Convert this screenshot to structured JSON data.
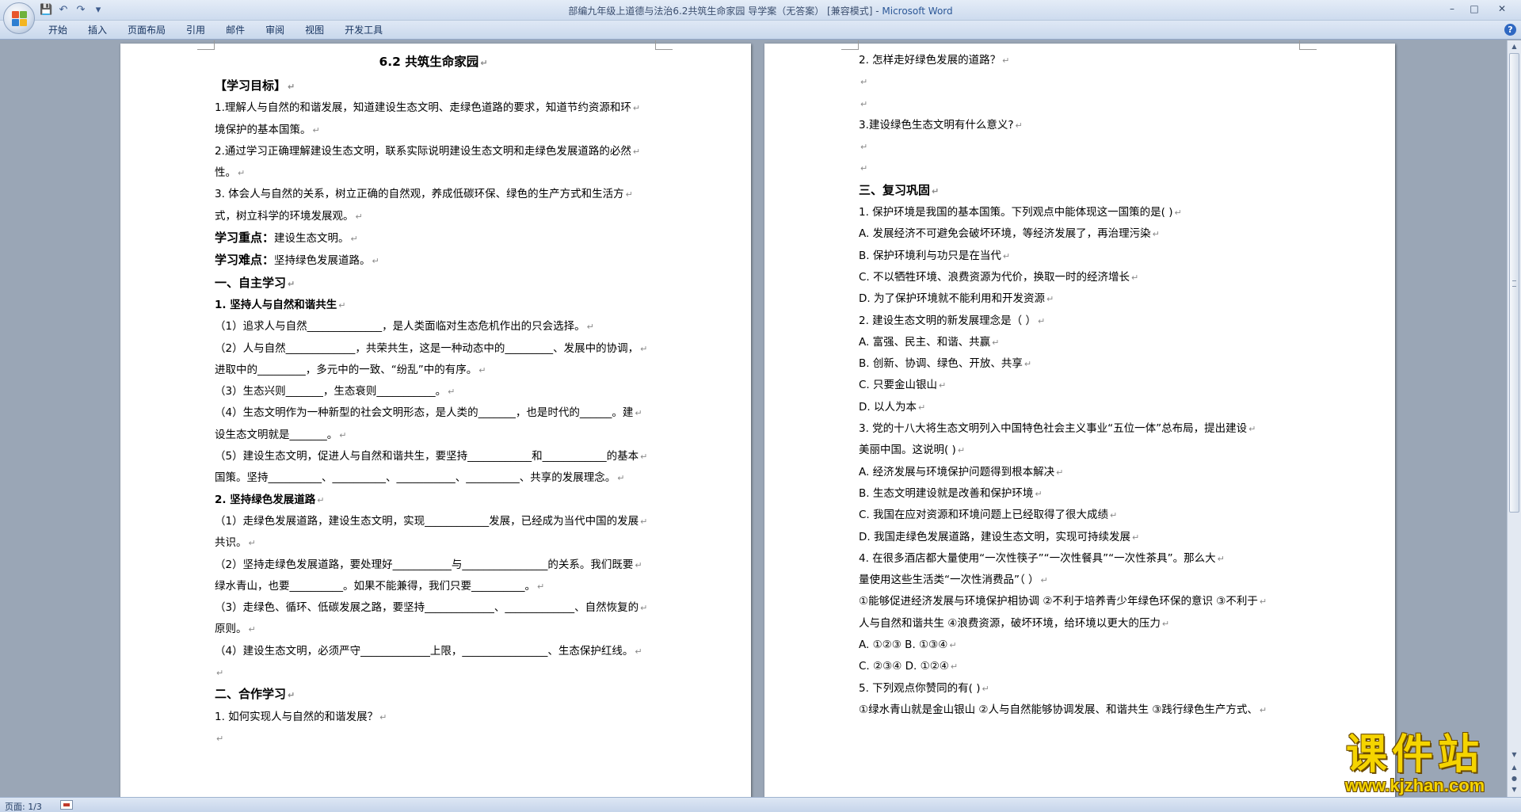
{
  "window": {
    "title": "部编九年级上道德与法治6.2共筑生命家园 导学案（无答案） [兼容模式] - ",
    "app_name": "Microsoft Word",
    "controls": [
      "–",
      "□",
      "✕"
    ]
  },
  "ribbon": {
    "tabs": [
      "开始",
      "插入",
      "页面布局",
      "引用",
      "邮件",
      "审阅",
      "视图",
      "开发工具"
    ]
  },
  "colors": {
    "office_logo": [
      "#e8572d",
      "#6fb23d",
      "#2f7fd1",
      "#f4b521"
    ]
  },
  "page1": {
    "lines": [
      {
        "t": "6.2  共筑生命家园",
        "s": "title"
      },
      {
        "t": "【学习目标】",
        "s": "h"
      },
      {
        "t": "1.理解人与自然的和谐发展，知道建设生态文明、走绿色道路的要求，知道节约资源和环"
      },
      {
        "t": "境保护的基本国策。"
      },
      {
        "t": "2.通过学习正确理解建设生态文明，联系实际说明建设生态文明和走绿色发展道路的必然"
      },
      {
        "t": "性。"
      },
      {
        "t": "3. 体会人与自然的关系，树立正确的自然观，养成低碳环保、绿色的生产方式和生活方"
      },
      {
        "t": "式，树立科学的环境发展观。"
      },
      {
        "t": "学习重点：",
        "rest": "建设生态文明。",
        "s": "lead"
      },
      {
        "t": "学习难点：",
        "rest": "坚持绿色发展道路。",
        "s": "lead"
      },
      {
        "t": "一、自主学习",
        "s": "h"
      },
      {
        "t": "1. 坚持人与自然和谐共生",
        "s": "b"
      },
      {
        "t": "（1）追求人与自然______________，是人类面临对生态危机作出的只会选择。"
      },
      {
        "t": "（2）人与自然_____________，共荣共生，这是一种动态中的_________、发展中的协调，"
      },
      {
        "t": "进取中的_________，多元中的一致、“纷乱”中的有序。"
      },
      {
        "t": "（3）生态兴则_______，生态衰则___________。"
      },
      {
        "t": "（4）生态文明作为一种新型的社会文明形态，是人类的_______，也是时代的______。建"
      },
      {
        "t": "设生态文明就是_______。"
      },
      {
        "t": "（5）建设生态文明，促进人与自然和谐共生，要坚持____________和____________的基本"
      },
      {
        "t": "国策。坚持__________、__________、___________、__________、共享的发展理念。"
      },
      {
        "t": "2. 坚持绿色发展道路",
        "s": "b"
      },
      {
        "t": "（1）走绿色发展道路，建设生态文明，实现____________发展，已经成为当代中国的发展"
      },
      {
        "t": "共识。"
      },
      {
        "t": "（2）坚持走绿色发展道路，要处理好___________与________________的关系。我们既要"
      },
      {
        "t": "绿水青山，也要__________。如果不能兼得，我们只要__________。"
      },
      {
        "t": "（3）走绿色、循环、低碳发展之路，要坚持_____________、_____________、自然恢复的"
      },
      {
        "t": "原则。"
      },
      {
        "t": "（4）建设生态文明，必须严守_____________上限，________________、生态保护红线。"
      },
      {
        "t": ""
      },
      {
        "t": "二、合作学习",
        "s": "h"
      },
      {
        "t": "1. 如何实现人与自然的和谐发展？"
      },
      {
        "t": ""
      }
    ]
  },
  "page2": {
    "lines": [
      {
        "t": "2. 怎样走好绿色发展的道路？"
      },
      {
        "t": ""
      },
      {
        "t": ""
      },
      {
        "t": "3.建设绿色生态文明有什么意义?"
      },
      {
        "t": ""
      },
      {
        "t": ""
      },
      {
        "t": "三、复习巩固",
        "s": "h"
      },
      {
        "t": "1. 保护环境是我国的基本国策。下列观点中能体现这一国策的是(      )"
      },
      {
        "t": "A. 发展经济不可避免会破坏环境，等经济发展了，再治理污染"
      },
      {
        "t": "B. 保护环境利与功只是在当代"
      },
      {
        "t": "C. 不以牺牲环境、浪费资源为代价，换取一时的经济增长"
      },
      {
        "t": "D. 为了保护环境就不能利用和开发资源"
      },
      {
        "t": "2. 建设生态文明的新发展理念是（      ）"
      },
      {
        "t": "A. 富强、民主、和谐、共赢"
      },
      {
        "t": "B. 创新、协调、绿色、开放、共享"
      },
      {
        "t": "C. 只要金山银山"
      },
      {
        "t": "D. 以人为本"
      },
      {
        "t": "3. 党的十八大将生态文明列入中国特色社会主义事业“五位一体”总布局，提出建设"
      },
      {
        "t": "美丽中国。这说明(      )"
      },
      {
        "t": "A. 经济发展与环境保护问题得到根本解决"
      },
      {
        "t": "B. 生态文明建设就是改善和保护环境"
      },
      {
        "t": "C. 我国在应对资源和环境问题上已经取得了很大成绩"
      },
      {
        "t": "D. 我国走绿色发展道路，建设生态文明，实现可持续发展"
      },
      {
        "t": "4.  在很多酒店都大量使用“一次性筷子”“一次性餐具”“一次性茶具”。那么大"
      },
      {
        "t": "量使用这些生活类“一次性消费品”（      ）"
      },
      {
        "t": "①能够促进经济发展与环境保护相协调   ②不利于培养青少年绿色环保的意识   ③不利于"
      },
      {
        "t": "人与自然和谐共生   ④浪费资源，破坏环境，给环境以更大的压力"
      },
      {
        "t": "A. ①②③         B. ①③④"
      },
      {
        "t": "C. ②③④         D. ①②④"
      },
      {
        "t": "5. 下列观点你赞同的有(      )"
      },
      {
        "t": "①绿水青山就是金山银山   ②人与自然能够协调发展、和谐共生   ③践行绿色生产方式、"
      }
    ]
  },
  "statusbar": {
    "page_count": "页面: 1/3"
  },
  "watermark": {
    "title": "课件站",
    "url": "www.kjzhan.com"
  }
}
